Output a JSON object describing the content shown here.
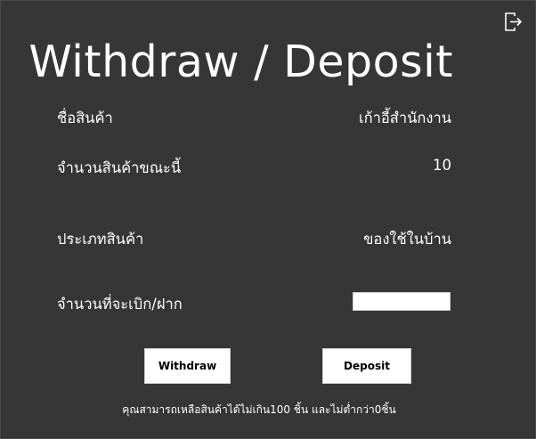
{
  "window": {
    "title": "Withdraw / Deposit",
    "exit_icon": "exit-icon",
    "background_color": "#363636"
  },
  "fields": {
    "product_name_label": "ชื่อสินค้า",
    "product_name_value": "เก้าอี้สำนักงาน",
    "current_qty_label": "จำนวนสินค้าขณะนี้",
    "current_qty_value": "10",
    "category_label": "ประเภทสินค้า",
    "category_value": "ของใช้ในบ้าน",
    "amount_label": "จำนวนที่จะเบิก/ฝาก",
    "amount_input_value": ""
  },
  "buttons": {
    "withdraw_label": "Withdraw",
    "deposit_label": "Deposit"
  },
  "note": "คุณสามารถเหลือสินค้าได้ไม่เกิน100 ชิ้น และไม่ต่ำกว่า0ชิ้น"
}
